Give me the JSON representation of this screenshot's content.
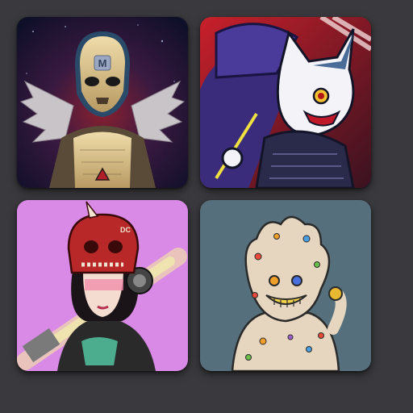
{
  "grid": {
    "items": [
      {
        "icon": "masked-warrior-avatar",
        "logo_text": "M",
        "bg": "#1b1530"
      },
      {
        "icon": "white-cat-samurai-avatar",
        "bg": "#2a1a4a"
      },
      {
        "icon": "demon-skull-helmet-girl-avatar",
        "logo_text": "DC",
        "bg": "#d98ae6"
      },
      {
        "icon": "candy-hand-creature-avatar",
        "bg": "#55707c"
      }
    ]
  }
}
